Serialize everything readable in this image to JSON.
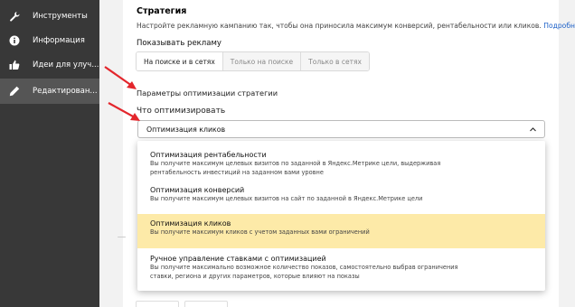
{
  "sidebar": {
    "items": [
      {
        "label": "Инструменты",
        "icon": "wrench-icon"
      },
      {
        "label": "Информация",
        "icon": "info-icon"
      },
      {
        "label": "Идеи для улуч...",
        "icon": "thumbs-up-icon"
      },
      {
        "label": "Редактирован...",
        "icon": "pencil-icon"
      }
    ]
  },
  "strategy": {
    "title": "Стратегия",
    "description": "Настройте рекламную кампанию так, чтобы она приносила максимум конверсий, рентабельности или кликов.",
    "more_link": "Подробнее",
    "show_ads_label": "Показывать рекламу",
    "placements": [
      "На поиске и в сетях",
      "Только на поиске",
      "Только в сетях"
    ],
    "selected_placement": "На поиске и в сетях"
  },
  "optimization": {
    "params_title": "Параметры оптимизации стратегии",
    "what_label": "Что оптимизировать",
    "selected": "Оптимизация кликов",
    "options": [
      {
        "title": "Оптимизация рентабельности",
        "desc": [
          "Вы получите максимум целевых визитов по заданной в Яндекс.Метрике цели, выдерживая",
          "рентабельность инвестиций на заданном вами уровне"
        ]
      },
      {
        "title": "Оптимизация конверсий",
        "desc": [
          "Вы получите максимум целевых визитов на сайт по заданной в Яндекс.Метрике цели"
        ]
      },
      {
        "title": "Оптимизация кликов",
        "desc": [
          "Вы получите максимум кликов с учетом заданных вами ограничений"
        ]
      },
      {
        "title": "Ручное управление ставками с оптимизацией",
        "desc": [
          "Вы получите максимально возможное количество показов, самостоятельно выбрав ограничения",
          "ставки, региона и других параметров, которые влияют на показы"
        ]
      }
    ]
  },
  "colors": {
    "sidebar_bg": "#383838",
    "highlight": "#fdeaa8",
    "arrow": "#e3262c",
    "link": "#1a5fc8"
  }
}
